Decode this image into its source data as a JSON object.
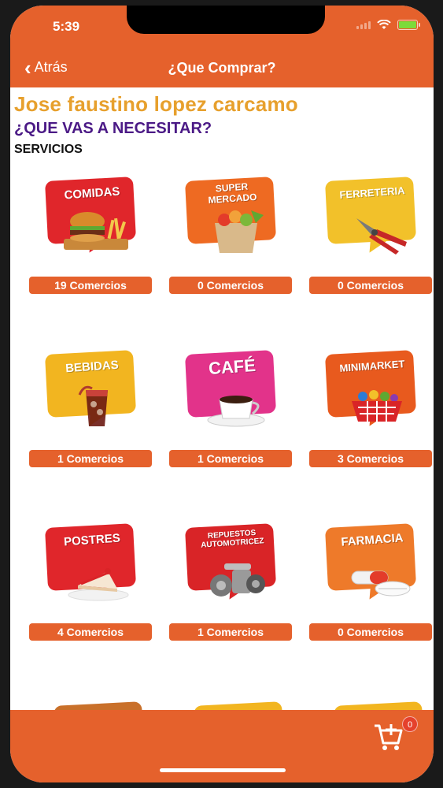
{
  "status": {
    "time": "5:39"
  },
  "nav": {
    "back_label": "Atrás",
    "title": "¿Que Comprar?"
  },
  "header": {
    "user_name": "Jose faustino lopez carcamo",
    "question": "¿QUE VAS A NECESITAR?",
    "section": "SERVICIOS"
  },
  "categories": [
    {
      "label": "COMIDAS",
      "count": "19 Comercios",
      "color": "#E0262B",
      "icon": "burger-icon"
    },
    {
      "label": "SUPER MERCADO",
      "count": "0 Comercios",
      "color": "#EE6A22",
      "icon": "grocery-bag-icon"
    },
    {
      "label": "FERRETERIA",
      "count": "0 Comercios",
      "color": "#F2C12A",
      "icon": "pliers-icon"
    },
    {
      "label": "BEBIDAS",
      "count": "1 Comercios",
      "color": "#F2B520",
      "icon": "drink-glass-icon"
    },
    {
      "label": "CAFÉ",
      "count": "1 Comercios",
      "color": "#E2338A",
      "icon": "coffee-cup-icon"
    },
    {
      "label": "MINIMARKET",
      "count": "3 Comercios",
      "color": "#E85A1E",
      "icon": "shopping-basket-icon"
    },
    {
      "label": "POSTRES",
      "count": "4 Comercios",
      "color": "#E0262B",
      "icon": "cake-icon"
    },
    {
      "label": "REPUESTOS AUTOMOTRICEZ",
      "count": "1 Comercios",
      "color": "#D92427",
      "icon": "car-parts-icon"
    },
    {
      "label": "FARMACIA",
      "count": "0 Comercios",
      "color": "#EE7A2A",
      "icon": "pills-icon"
    }
  ],
  "cart": {
    "count": "0"
  },
  "colors": {
    "primary": "#E5612C",
    "title": "#E7A02D",
    "question": "#4B1A86"
  }
}
